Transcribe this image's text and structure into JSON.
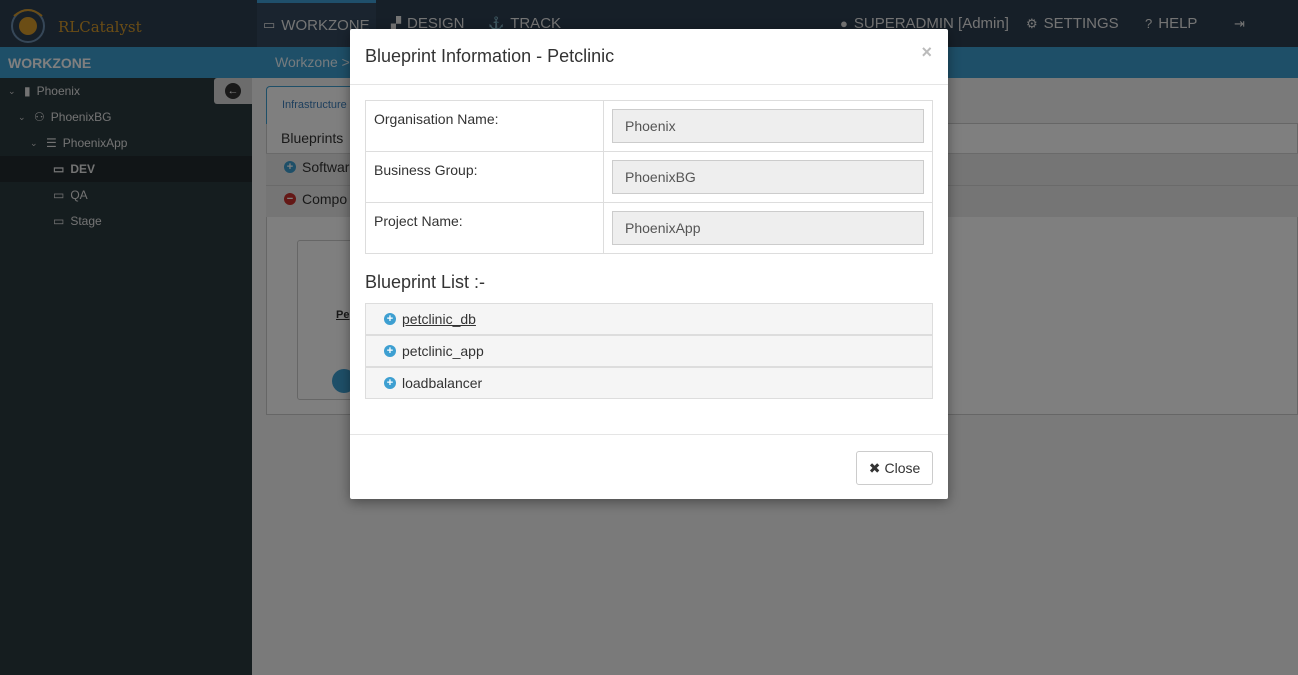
{
  "app": {
    "logo_text": "RLCatalyst"
  },
  "nav": {
    "workzone": "WORKZONE",
    "design": "DESIGN",
    "track": "TRACK",
    "user": "SUPERADMIN [Admin]",
    "settings": "SETTINGS",
    "help": "HELP"
  },
  "sidebar": {
    "header": "WORKZONE",
    "tree": [
      {
        "label": "Phoenix",
        "icon": "building-icon"
      },
      {
        "label": "PhoenixBG",
        "icon": "users-icon"
      },
      {
        "label": "PhoenixApp",
        "icon": "server-icon"
      },
      {
        "label": "DEV",
        "icon": "monitor-icon"
      },
      {
        "label": "QA",
        "icon": "monitor-icon"
      },
      {
        "label": "Stage",
        "icon": "monitor-icon"
      }
    ]
  },
  "main": {
    "breadcrumb": "Workzone >",
    "tab_label": "Infrastructure",
    "blueprints_label": "Blueprints",
    "strip_software": "Softwar",
    "strip_compo": "Compo",
    "card_label": "Pe"
  },
  "modal": {
    "title": "Blueprint Information - Petclinic",
    "close_x": "×",
    "fields": [
      {
        "label": "Organisation Name:",
        "value": "Phoenix"
      },
      {
        "label": "Business Group:",
        "value": "PhoenixBG"
      },
      {
        "label": "Project Name:",
        "value": "PhoenixApp"
      }
    ],
    "list_title": "Blueprint List :-",
    "blueprints": [
      " petclinic_db",
      "petclinic_app",
      "loadbalancer"
    ],
    "close_button": "Close"
  },
  "colors": {
    "accent": "#3d9fd1",
    "navbar": "#2c3e50",
    "sidebar": "#2b3a3f"
  }
}
